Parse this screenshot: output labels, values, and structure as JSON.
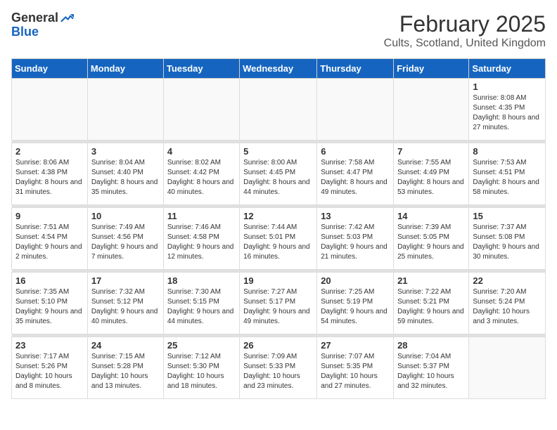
{
  "header": {
    "logo_general": "General",
    "logo_blue": "Blue",
    "month": "February 2025",
    "location": "Cults, Scotland, United Kingdom"
  },
  "days_of_week": [
    "Sunday",
    "Monday",
    "Tuesday",
    "Wednesday",
    "Thursday",
    "Friday",
    "Saturday"
  ],
  "weeks": [
    [
      {
        "day": "",
        "info": ""
      },
      {
        "day": "",
        "info": ""
      },
      {
        "day": "",
        "info": ""
      },
      {
        "day": "",
        "info": ""
      },
      {
        "day": "",
        "info": ""
      },
      {
        "day": "",
        "info": ""
      },
      {
        "day": "1",
        "info": "Sunrise: 8:08 AM\nSunset: 4:35 PM\nDaylight: 8 hours and 27 minutes."
      }
    ],
    [
      {
        "day": "2",
        "info": "Sunrise: 8:06 AM\nSunset: 4:38 PM\nDaylight: 8 hours and 31 minutes."
      },
      {
        "day": "3",
        "info": "Sunrise: 8:04 AM\nSunset: 4:40 PM\nDaylight: 8 hours and 35 minutes."
      },
      {
        "day": "4",
        "info": "Sunrise: 8:02 AM\nSunset: 4:42 PM\nDaylight: 8 hours and 40 minutes."
      },
      {
        "day": "5",
        "info": "Sunrise: 8:00 AM\nSunset: 4:45 PM\nDaylight: 8 hours and 44 minutes."
      },
      {
        "day": "6",
        "info": "Sunrise: 7:58 AM\nSunset: 4:47 PM\nDaylight: 8 hours and 49 minutes."
      },
      {
        "day": "7",
        "info": "Sunrise: 7:55 AM\nSunset: 4:49 PM\nDaylight: 8 hours and 53 minutes."
      },
      {
        "day": "8",
        "info": "Sunrise: 7:53 AM\nSunset: 4:51 PM\nDaylight: 8 hours and 58 minutes."
      }
    ],
    [
      {
        "day": "9",
        "info": "Sunrise: 7:51 AM\nSunset: 4:54 PM\nDaylight: 9 hours and 2 minutes."
      },
      {
        "day": "10",
        "info": "Sunrise: 7:49 AM\nSunset: 4:56 PM\nDaylight: 9 hours and 7 minutes."
      },
      {
        "day": "11",
        "info": "Sunrise: 7:46 AM\nSunset: 4:58 PM\nDaylight: 9 hours and 12 minutes."
      },
      {
        "day": "12",
        "info": "Sunrise: 7:44 AM\nSunset: 5:01 PM\nDaylight: 9 hours and 16 minutes."
      },
      {
        "day": "13",
        "info": "Sunrise: 7:42 AM\nSunset: 5:03 PM\nDaylight: 9 hours and 21 minutes."
      },
      {
        "day": "14",
        "info": "Sunrise: 7:39 AM\nSunset: 5:05 PM\nDaylight: 9 hours and 25 minutes."
      },
      {
        "day": "15",
        "info": "Sunrise: 7:37 AM\nSunset: 5:08 PM\nDaylight: 9 hours and 30 minutes."
      }
    ],
    [
      {
        "day": "16",
        "info": "Sunrise: 7:35 AM\nSunset: 5:10 PM\nDaylight: 9 hours and 35 minutes."
      },
      {
        "day": "17",
        "info": "Sunrise: 7:32 AM\nSunset: 5:12 PM\nDaylight: 9 hours and 40 minutes."
      },
      {
        "day": "18",
        "info": "Sunrise: 7:30 AM\nSunset: 5:15 PM\nDaylight: 9 hours and 44 minutes."
      },
      {
        "day": "19",
        "info": "Sunrise: 7:27 AM\nSunset: 5:17 PM\nDaylight: 9 hours and 49 minutes."
      },
      {
        "day": "20",
        "info": "Sunrise: 7:25 AM\nSunset: 5:19 PM\nDaylight: 9 hours and 54 minutes."
      },
      {
        "day": "21",
        "info": "Sunrise: 7:22 AM\nSunset: 5:21 PM\nDaylight: 9 hours and 59 minutes."
      },
      {
        "day": "22",
        "info": "Sunrise: 7:20 AM\nSunset: 5:24 PM\nDaylight: 10 hours and 3 minutes."
      }
    ],
    [
      {
        "day": "23",
        "info": "Sunrise: 7:17 AM\nSunset: 5:26 PM\nDaylight: 10 hours and 8 minutes."
      },
      {
        "day": "24",
        "info": "Sunrise: 7:15 AM\nSunset: 5:28 PM\nDaylight: 10 hours and 13 minutes."
      },
      {
        "day": "25",
        "info": "Sunrise: 7:12 AM\nSunset: 5:30 PM\nDaylight: 10 hours and 18 minutes."
      },
      {
        "day": "26",
        "info": "Sunrise: 7:09 AM\nSunset: 5:33 PM\nDaylight: 10 hours and 23 minutes."
      },
      {
        "day": "27",
        "info": "Sunrise: 7:07 AM\nSunset: 5:35 PM\nDaylight: 10 hours and 27 minutes."
      },
      {
        "day": "28",
        "info": "Sunrise: 7:04 AM\nSunset: 5:37 PM\nDaylight: 10 hours and 32 minutes."
      },
      {
        "day": "",
        "info": ""
      }
    ]
  ]
}
